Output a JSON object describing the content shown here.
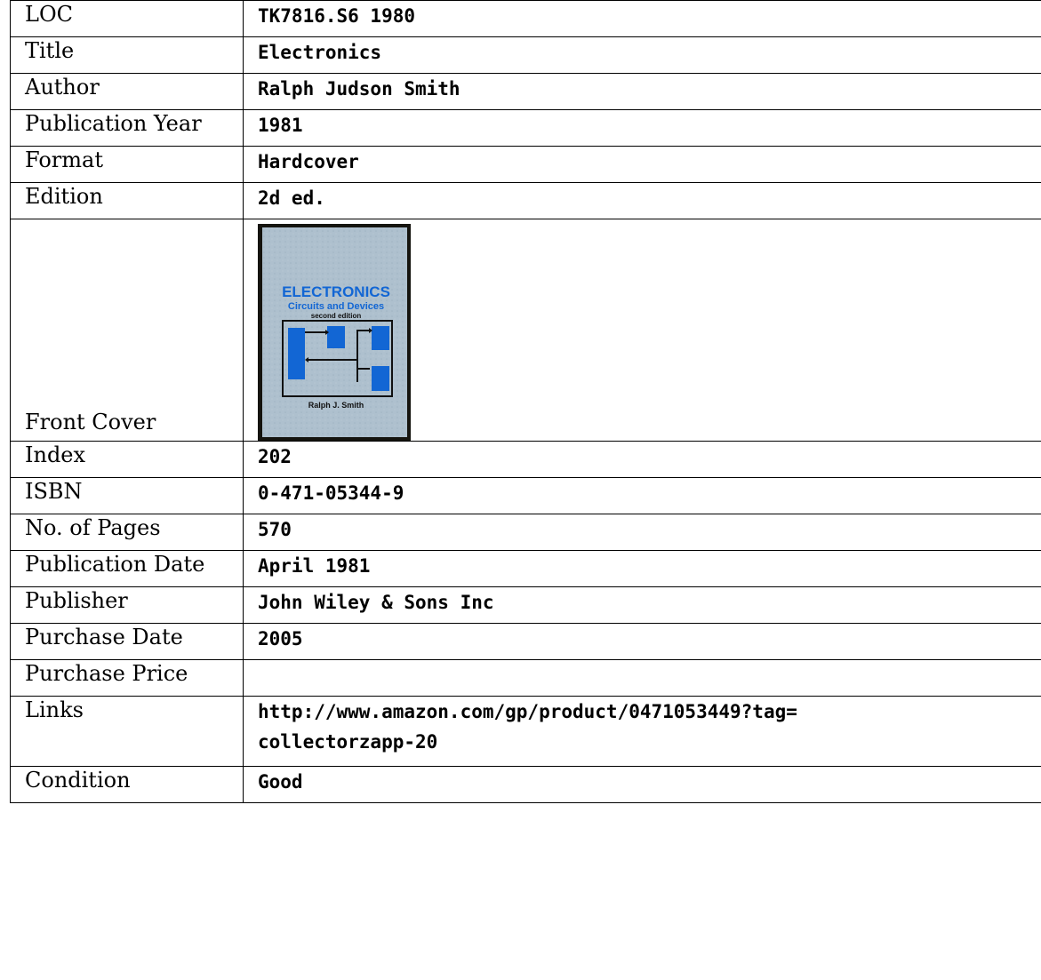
{
  "rows": [
    {
      "label": "LOC",
      "value": "TK7816.S6 1980"
    },
    {
      "label": "Title",
      "value": "Electronics"
    },
    {
      "label": "Author",
      "value": "Ralph Judson Smith"
    },
    {
      "label": "Publication Year",
      "value": "1981"
    },
    {
      "label": "Format",
      "value": "Hardcover"
    },
    {
      "label": "Edition",
      "value": "2d ed."
    },
    {
      "label": "Front Cover"
    },
    {
      "label": "Index",
      "value": "202"
    },
    {
      "label": "ISBN",
      "value": "0-471-05344-9"
    },
    {
      "label": "No. of Pages",
      "value": "570"
    },
    {
      "label": "Publication Date",
      "value": "April 1981"
    },
    {
      "label": "Publisher",
      "value": "John Wiley & Sons Inc"
    },
    {
      "label": "Purchase Date",
      "value": "2005"
    },
    {
      "label": "Purchase Price",
      "value": ""
    },
    {
      "label": "Links",
      "value_lines": [
        "http://www.amazon.com/gp/product/0471053449?tag=",
        "collectorzapp-20"
      ]
    },
    {
      "label": "Condition",
      "value": "Good"
    }
  ],
  "cover": {
    "title": "ELECTRONICS",
    "subtitle": "Circuits and Devices",
    "edition": "second edition",
    "author": "Ralph J. Smith",
    "colors": {
      "background": "#a9bccb",
      "accent": "#1266d4",
      "border": "#15140f"
    }
  }
}
